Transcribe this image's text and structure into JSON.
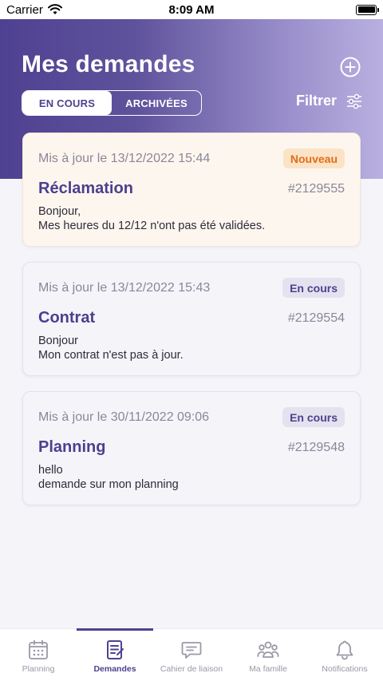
{
  "status_bar": {
    "carrier": "Carrier",
    "time": "8:09 AM"
  },
  "header": {
    "title": "Mes demandes",
    "tabs": [
      {
        "label": "EN COURS",
        "active": true
      },
      {
        "label": "ARCHIVÉES",
        "active": false
      }
    ],
    "filter_label": "Filtrer",
    "icons": {
      "add": "add-circle-icon",
      "filter": "sliders-icon"
    }
  },
  "requests": [
    {
      "date": "Mis à jour le 13/12/2022 15:44",
      "badge": "Nouveau",
      "badge_type": "nouveau",
      "title": "Réclamation",
      "ref": "#2129555",
      "line1": "Bonjour,",
      "line2": "Mes heures du 12/12 n'ont pas été validées."
    },
    {
      "date": "Mis à jour le 13/12/2022 15:43",
      "badge": "En cours",
      "badge_type": "encours",
      "title": "Contrat",
      "ref": "#2129554",
      "line1": "Bonjour",
      "line2": "Mon contrat n'est pas à jour."
    },
    {
      "date": "Mis à jour le 30/11/2022 09:06",
      "badge": "En cours",
      "badge_type": "encours",
      "title": "Planning",
      "ref": "#2129548",
      "line1": "hello",
      "line2": "demande sur mon planning"
    }
  ],
  "tabbar": [
    {
      "label": "Planning",
      "icon": "calendar-icon"
    },
    {
      "label": "Demandes",
      "icon": "document-icon",
      "active": true
    },
    {
      "label": "Cahier de liaison",
      "icon": "chat-icon"
    },
    {
      "label": "Ma famille",
      "icon": "family-icon"
    },
    {
      "label": "Notifications",
      "icon": "bell-icon"
    }
  ],
  "colors": {
    "primary": "#4f4191",
    "accent_orange": "#e06e17",
    "background": "#f5f4f9"
  }
}
